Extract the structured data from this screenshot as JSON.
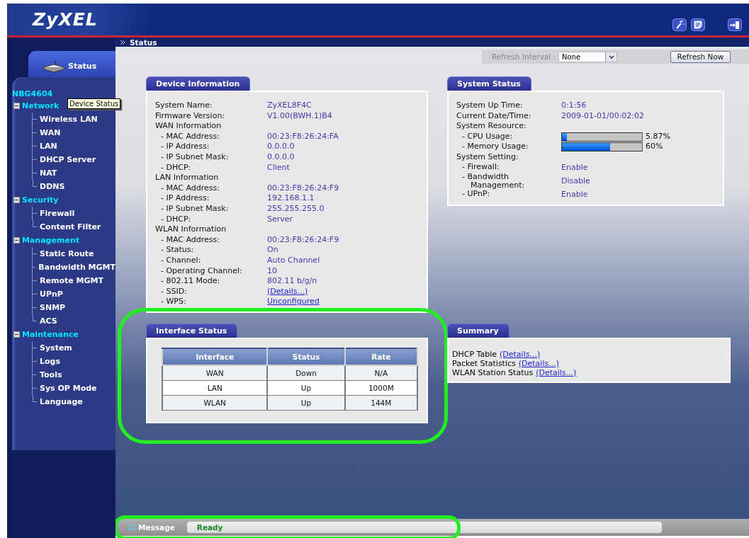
{
  "header": {
    "logo": "ZyXEL"
  },
  "breadcrumb": "Status",
  "sidebar": {
    "tab": {
      "label": "Status",
      "selected": true
    },
    "device": "NBG4604",
    "tooltip": "Device Status",
    "tree": [
      {
        "label": "Network",
        "expanded": true,
        "children": [
          {
            "label": "Wireless LAN"
          },
          {
            "label": "WAN"
          },
          {
            "label": "LAN"
          },
          {
            "label": "DHCP Server"
          },
          {
            "label": "NAT"
          },
          {
            "label": "DDNS"
          }
        ]
      },
      {
        "label": "Security",
        "expanded": true,
        "children": [
          {
            "label": "Firewall"
          },
          {
            "label": "Content Filter"
          }
        ]
      },
      {
        "label": "Management",
        "expanded": true,
        "children": [
          {
            "label": "Static Route"
          },
          {
            "label": "Bandwidth MGMT"
          },
          {
            "label": "Remote MGMT"
          },
          {
            "label": "UPnP"
          },
          {
            "label": "SNMP"
          },
          {
            "label": "ACS"
          }
        ]
      },
      {
        "label": "Maintenance",
        "expanded": true,
        "children": [
          {
            "label": "System"
          },
          {
            "label": "Logs"
          },
          {
            "label": "Tools"
          },
          {
            "label": "Sys OP Mode"
          },
          {
            "label": "Language"
          }
        ]
      }
    ]
  },
  "refresh": {
    "label": "Refresh Interval :",
    "value": "None",
    "button": "Refresh Now"
  },
  "device_information": {
    "title": "Device Information",
    "rows": [
      {
        "kind": "item",
        "label": "System Name:",
        "value": "ZyXEL8F4C"
      },
      {
        "kind": "item",
        "label": "Firmware Version:",
        "value": "V1.00(BWH.1)B4"
      },
      {
        "kind": "heading",
        "label": "WAN Information"
      },
      {
        "kind": "sub",
        "label": "- MAC Address:",
        "value": "00:23:F8:26:24:FA"
      },
      {
        "kind": "sub",
        "label": "- IP Address:",
        "value": "0.0.0.0"
      },
      {
        "kind": "sub",
        "label": "- IP Subnet Mask:",
        "value": "0.0.0.0"
      },
      {
        "kind": "sub",
        "label": "- DHCP:",
        "value": "Client"
      },
      {
        "kind": "heading",
        "label": "LAN Information"
      },
      {
        "kind": "sub",
        "label": "- MAC Address:",
        "value": "00:23:F8:26:24:F9"
      },
      {
        "kind": "sub",
        "label": "- IP Address:",
        "value": "192.168.1.1"
      },
      {
        "kind": "sub",
        "label": "- IP Subnet Mask:",
        "value": "255.255.255.0"
      },
      {
        "kind": "sub",
        "label": "- DHCP:",
        "value": "Server"
      },
      {
        "kind": "heading",
        "label": "WLAN Information"
      },
      {
        "kind": "sub",
        "label": "- MAC Address:",
        "value": "00:23:F8:26:24:F9"
      },
      {
        "kind": "sub",
        "label": "- Status:",
        "value": "On"
      },
      {
        "kind": "sub",
        "label": "- Channel:",
        "value": "Auto Channel"
      },
      {
        "kind": "sub",
        "label": "- Operating Channel:",
        "value": "10"
      },
      {
        "kind": "sub",
        "label": "- 802.11 Mode:",
        "value": "802.11 b/g/n"
      },
      {
        "kind": "sublink",
        "label": "- SSID:",
        "value": "(Details...)"
      },
      {
        "kind": "sublink",
        "label": "- WPS:",
        "value": "Unconfigured"
      }
    ]
  },
  "system_status": {
    "title": "System Status",
    "rows": [
      {
        "kind": "item",
        "label": "System Up Time:",
        "value": "0:1:56"
      },
      {
        "kind": "item",
        "label": "Current Date/Time:",
        "value": "2009-01-01/00:02:02"
      },
      {
        "kind": "heading",
        "label": "System Resource:"
      },
      {
        "kind": "meter",
        "label": "- CPU Usage:",
        "level": 0.0587,
        "reading": "5.87%"
      },
      {
        "kind": "meter",
        "label": "- Memory Usage:",
        "level": 0.6,
        "reading": "60%"
      },
      {
        "kind": "heading",
        "label": "System Setting:"
      },
      {
        "kind": "sub",
        "label": "- Firewall:",
        "value": "Enable"
      },
      {
        "kind": "sub",
        "label": "- Bandwidth Management:",
        "value": "Disable"
      },
      {
        "kind": "sub",
        "label": "- UPnP:",
        "value": "Enable"
      }
    ]
  },
  "interface_status": {
    "title": "Interface Status",
    "highlighted": true,
    "columns": [
      "Interface",
      "Status",
      "Rate"
    ],
    "rows": [
      [
        "WAN",
        "Down",
        "N/A"
      ],
      [
        "LAN",
        "Up",
        "1000M"
      ],
      [
        "WLAN",
        "Up",
        "144M"
      ]
    ]
  },
  "summary": {
    "title": "Summary",
    "rows": [
      {
        "label": "DHCP Table",
        "link": "(Details...)"
      },
      {
        "label": "Packet Statistics",
        "link": "(Details...)"
      },
      {
        "label": "WLAN Station Status",
        "link": "(Details...)"
      }
    ]
  },
  "status_bar": {
    "label": "Message",
    "value": "Ready",
    "highlighted": true
  }
}
